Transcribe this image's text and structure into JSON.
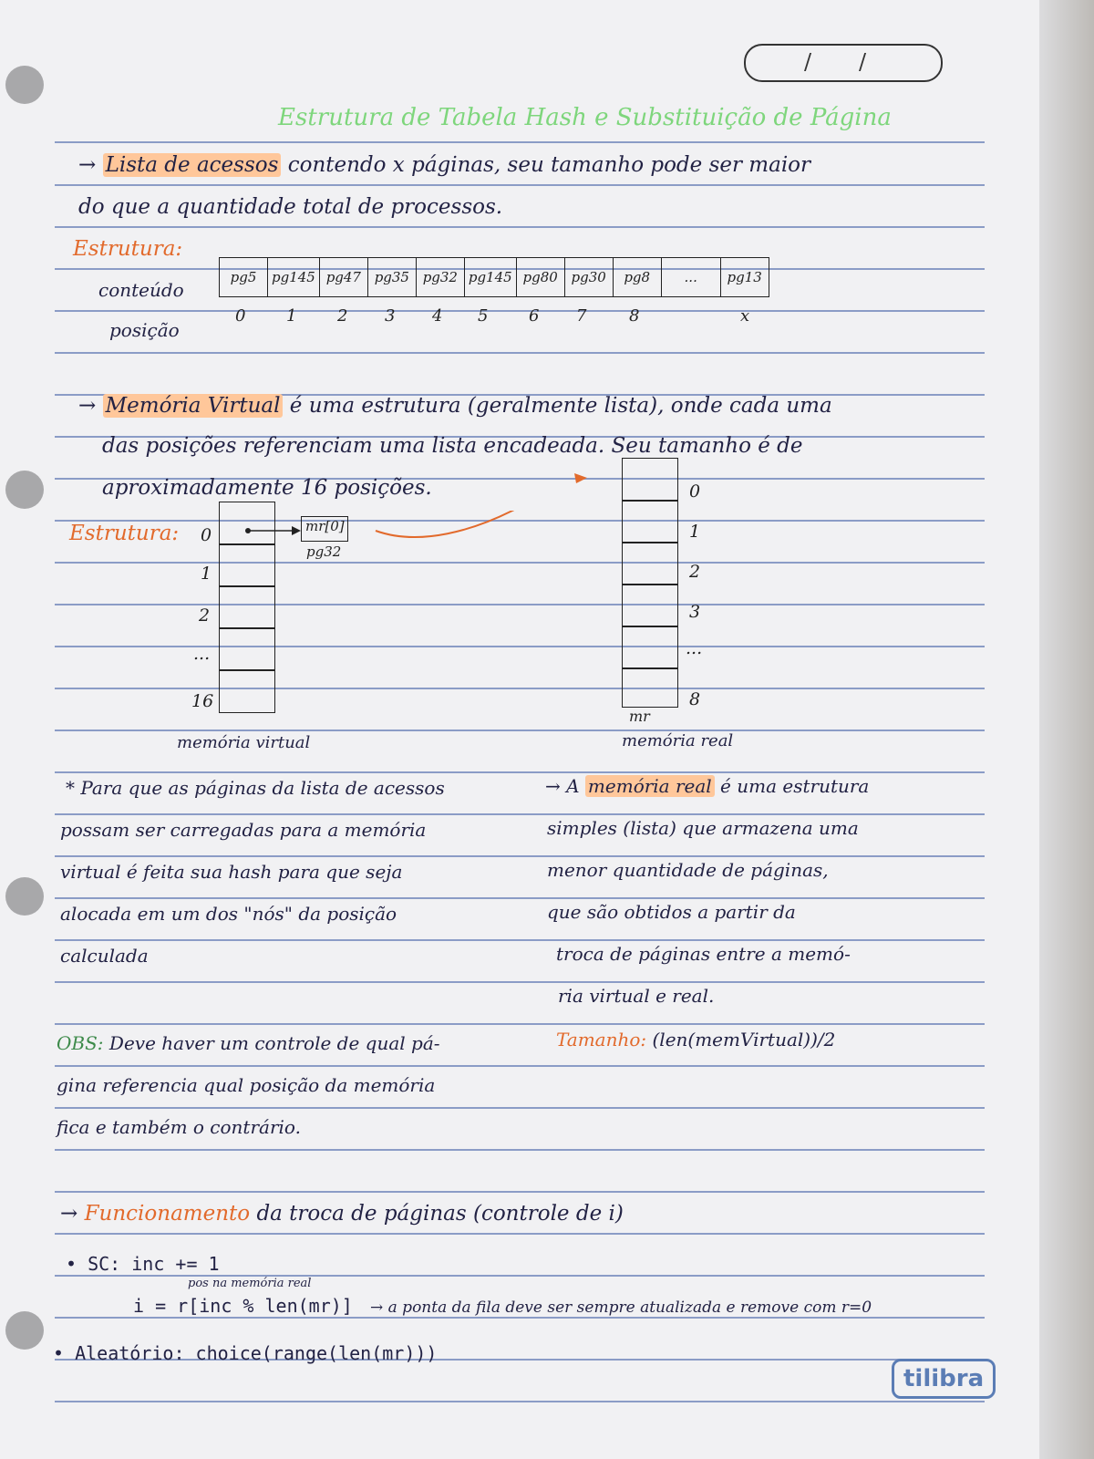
{
  "header": {
    "date_separators": [
      "/",
      "/"
    ],
    "title": "Estrutura de Tabela Hash e Substituição de Página"
  },
  "section1": {
    "line1_arrow": "→",
    "line1_highlight": "Lista de acessos",
    "line1_rest": "contendo x páginas, seu tamanho pode ser maior",
    "line2": "do que a quantidade total de processos.",
    "structure_label": "Estrutura:",
    "content_label": "conteúdo",
    "position_label": "posição",
    "cells": [
      "pg5",
      "pg145",
      "pg47",
      "pg35",
      "pg32",
      "pg145",
      "pg80",
      "pg30",
      "pg8",
      "...",
      "pg13"
    ],
    "positions": [
      "0",
      "1",
      "2",
      "3",
      "4",
      "5",
      "6",
      "7",
      "8",
      "",
      "x"
    ]
  },
  "section2": {
    "line1_arrow": "→",
    "line1_highlight": "Memória Virtual",
    "line1_rest": "é uma estrutura (geralmente lista), onde cada uma",
    "line2": "das posições referenciam uma lista encadeada. Seu tamanho é de",
    "line3": "aproximadamente 16 posições.",
    "structure_label": "Estrutura:",
    "virtual_indices": [
      "0",
      "1",
      "2",
      "...",
      "16"
    ],
    "node_label": "mr[0]",
    "node_sub": "pg32",
    "real_indices": [
      "0",
      "1",
      "2",
      "3",
      "...",
      "8"
    ],
    "real_caption_top": "mr",
    "virtual_caption": "memória virtual",
    "real_caption": "memória real"
  },
  "notes_left": {
    "lines": [
      "* Para que as páginas da lista de acessos",
      "possam ser carregadas para a memória",
      "virtual é feita sua hash para que seja",
      "alocada em um dos \"nós\" da posição",
      "calculada"
    ]
  },
  "notes_right": {
    "prefix": "→ A",
    "highlight": "memória real",
    "line1_rest": "é uma estrutura",
    "lines": [
      "simples (lista) que armazena uma",
      "menor quantidade de páginas,",
      "que são obtidos a partir da",
      "troca de páginas entre a memó-",
      "ria virtual e real."
    ],
    "size_label": "Tamanho:",
    "size_value": "(len(memVirtual))/2"
  },
  "obs": {
    "label": "OBS:",
    "line1_rest": "Deve haver um controle de qual pá-",
    "line2": "gina referencia qual posição da memória",
    "line3": "fica e também o contrário."
  },
  "section3": {
    "heading_arrow": "→",
    "heading_orange": "Funcionamento",
    "heading_rest": "da troca de páginas (controle de i)",
    "sc_line": "• SC: inc += 1",
    "small_note": "pos na memória real",
    "formula": "i = r[inc % len(mr)]",
    "formula_note": "→ a ponta da fila deve ser sempre atualizada e remove com r=0",
    "random_line": "• Aleatório: choice(range(len(mr)))"
  },
  "brand": {
    "logo": "tilibra"
  }
}
